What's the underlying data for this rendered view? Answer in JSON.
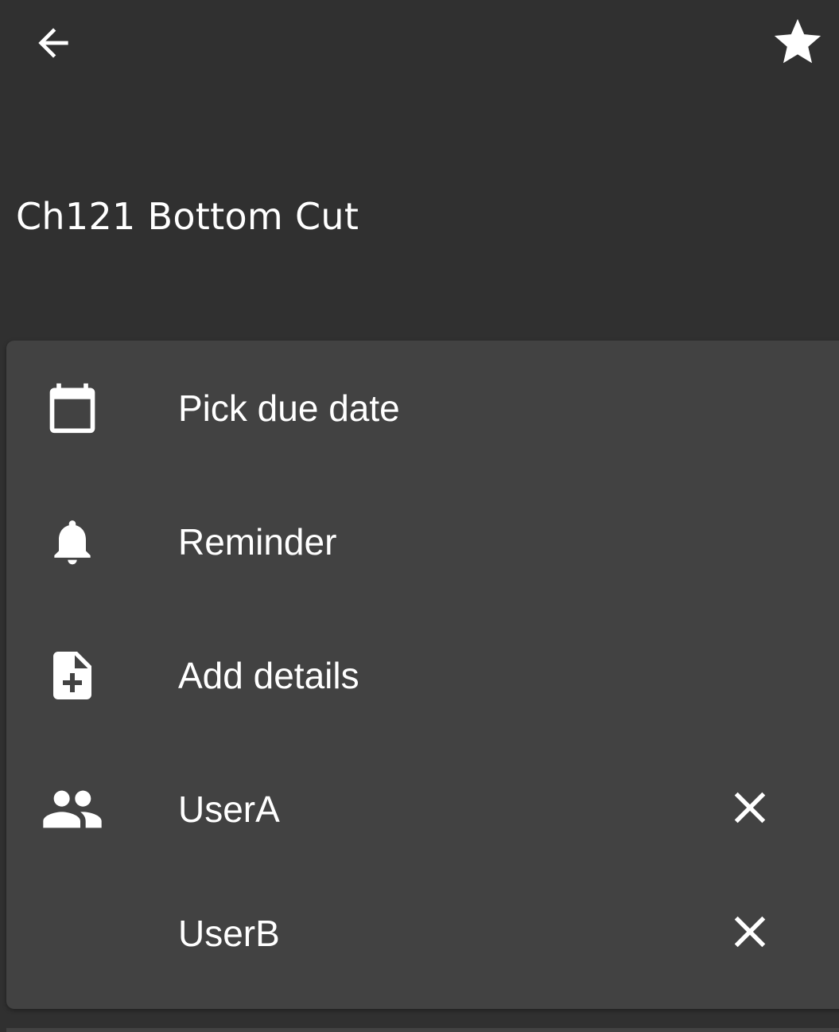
{
  "toolbar": {
    "back_icon": "arrow-back-icon",
    "star_icon": "star-icon"
  },
  "task": {
    "title": "Ch121 Bottom Cut"
  },
  "options": {
    "due_date_label": "Pick due date",
    "due_date_icon": "calendar-icon",
    "reminder_label": "Reminder",
    "reminder_icon": "bell-icon",
    "details_label": "Add details",
    "details_icon": "note-add-icon",
    "assignees_icon": "people-icon",
    "assignees": [
      {
        "name": "UserA",
        "remove_icon": "close-icon"
      },
      {
        "name": "UserB",
        "remove_icon": "close-icon"
      }
    ]
  },
  "colors": {
    "background": "#303030",
    "card": "#424242",
    "text": "#ffffff"
  }
}
